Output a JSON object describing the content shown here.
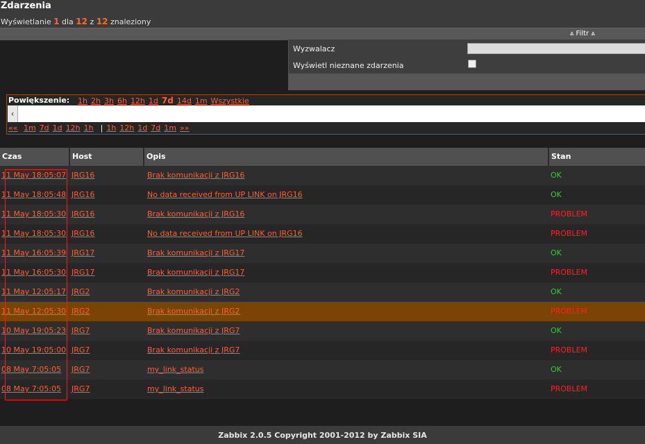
{
  "header": {
    "title": "Zdarzenia",
    "info_prefix": "Wyświetlanie",
    "info_from": "1",
    "info_dla": "dla",
    "info_to": "12",
    "info_z": "z",
    "info_total": "12",
    "info_suffix": "znaleziony"
  },
  "filter": {
    "toggle_label": "⩓ Filtr ⩓",
    "trigger_label": "Wyzwalacz",
    "trigger_value": "",
    "unknown_label": "Wyświetl nieznane zdarzenia",
    "unknown_checked": false
  },
  "zoom": {
    "label": "Powiększenie:",
    "options": [
      "1h",
      "2h",
      "3h",
      "6h",
      "12h",
      "1d",
      "7d",
      "14d",
      "1m",
      "Wszystkie"
    ],
    "active": "7d",
    "nav_prev_symbol": "««",
    "nav_back": [
      "1m",
      "7d",
      "1d",
      "12h",
      "1h"
    ],
    "nav_separator": "|",
    "nav_forward": [
      "1h",
      "12h",
      "1d",
      "7d",
      "1m"
    ],
    "nav_next_symbol": "»»",
    "scroll_left_symbol": "‹"
  },
  "table": {
    "columns": [
      "Czas",
      "Host",
      "Opis",
      "Stan"
    ],
    "rows": [
      {
        "time": "11 May 18:05:07",
        "host": "JRG16",
        "desc": "Brak komunikacji z JRG16",
        "status": "OK"
      },
      {
        "time": "11 May 18:05:48",
        "host": "JRG16",
        "desc": "No data received from UP LINK on JRG16",
        "status": "OK"
      },
      {
        "time": "11 May 18:05:30",
        "host": "JRG16",
        "desc": "Brak komunikacji z JRG16",
        "status": "PROBLEM"
      },
      {
        "time": "11 May 18:05:30",
        "host": "JRG16",
        "desc": "No data received from UP LINK on JRG16",
        "status": "PROBLEM"
      },
      {
        "time": "11 May 16:05:39",
        "host": "JRG17",
        "desc": "Brak komunikacji z JRG17",
        "status": "OK"
      },
      {
        "time": "11 May 16:05:30",
        "host": "JRG17",
        "desc": "Brak komunikacji z JRG17",
        "status": "PROBLEM"
      },
      {
        "time": "11 May 12:05:17",
        "host": "JRG2",
        "desc": "Brak komunikacji z JRG2",
        "status": "OK"
      },
      {
        "time": "11 May 12:05:30",
        "host": "JRG2",
        "desc": "Brak komunikacji z JRG2",
        "status": "PROBLEM",
        "highlight": true
      },
      {
        "time": "10 May 19:05:23",
        "host": "JRG7",
        "desc": "Brak komunikacji z JRG7",
        "status": "OK"
      },
      {
        "time": "10 May 19:05:00",
        "host": "JRG7",
        "desc": "Brak komunikacji z JRG7",
        "status": "PROBLEM"
      },
      {
        "time": "08 May 7:05:05",
        "host": "JRG7",
        "desc": "my_link_status",
        "status": "OK"
      },
      {
        "time": "08 May 7:05:05",
        "host": "JRG7",
        "desc": "my_link_status",
        "status": "PROBLEM"
      }
    ]
  },
  "colors": {
    "link": "#ff6030",
    "ok": "#2ed12e",
    "problem": "#ff2020",
    "highlight_row": "#7a4405",
    "selection_box": "#ff1a1a"
  },
  "footer": {
    "text": "Zabbix 2.0.5 Copyright 2001-2012 by Zabbix SIA"
  }
}
